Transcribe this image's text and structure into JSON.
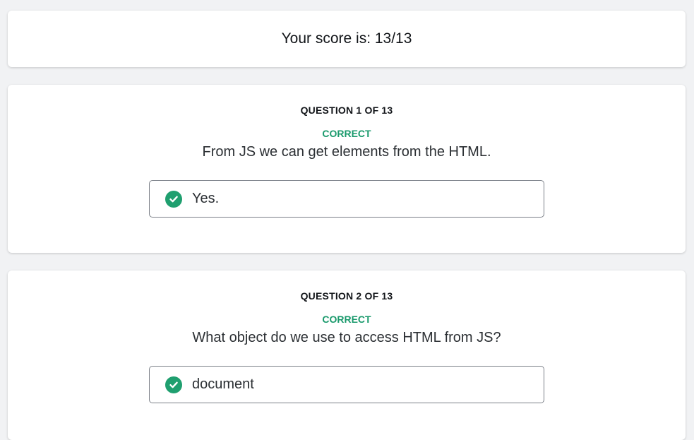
{
  "colors": {
    "correct": "#1a9a6c",
    "check_bg": "#1f9f6f"
  },
  "score": {
    "label": "Your score is: 13/13"
  },
  "questions": [
    {
      "header": "QUESTION 1 OF 13",
      "status": "CORRECT",
      "text": "From JS we can get elements from the HTML.",
      "answer": "Yes.",
      "answer_icon": "check-circle-icon"
    },
    {
      "header": "QUESTION 2 OF 13",
      "status": "CORRECT",
      "text": "What object do we use to access HTML from JS?",
      "answer": "document",
      "answer_icon": "check-circle-icon"
    }
  ]
}
